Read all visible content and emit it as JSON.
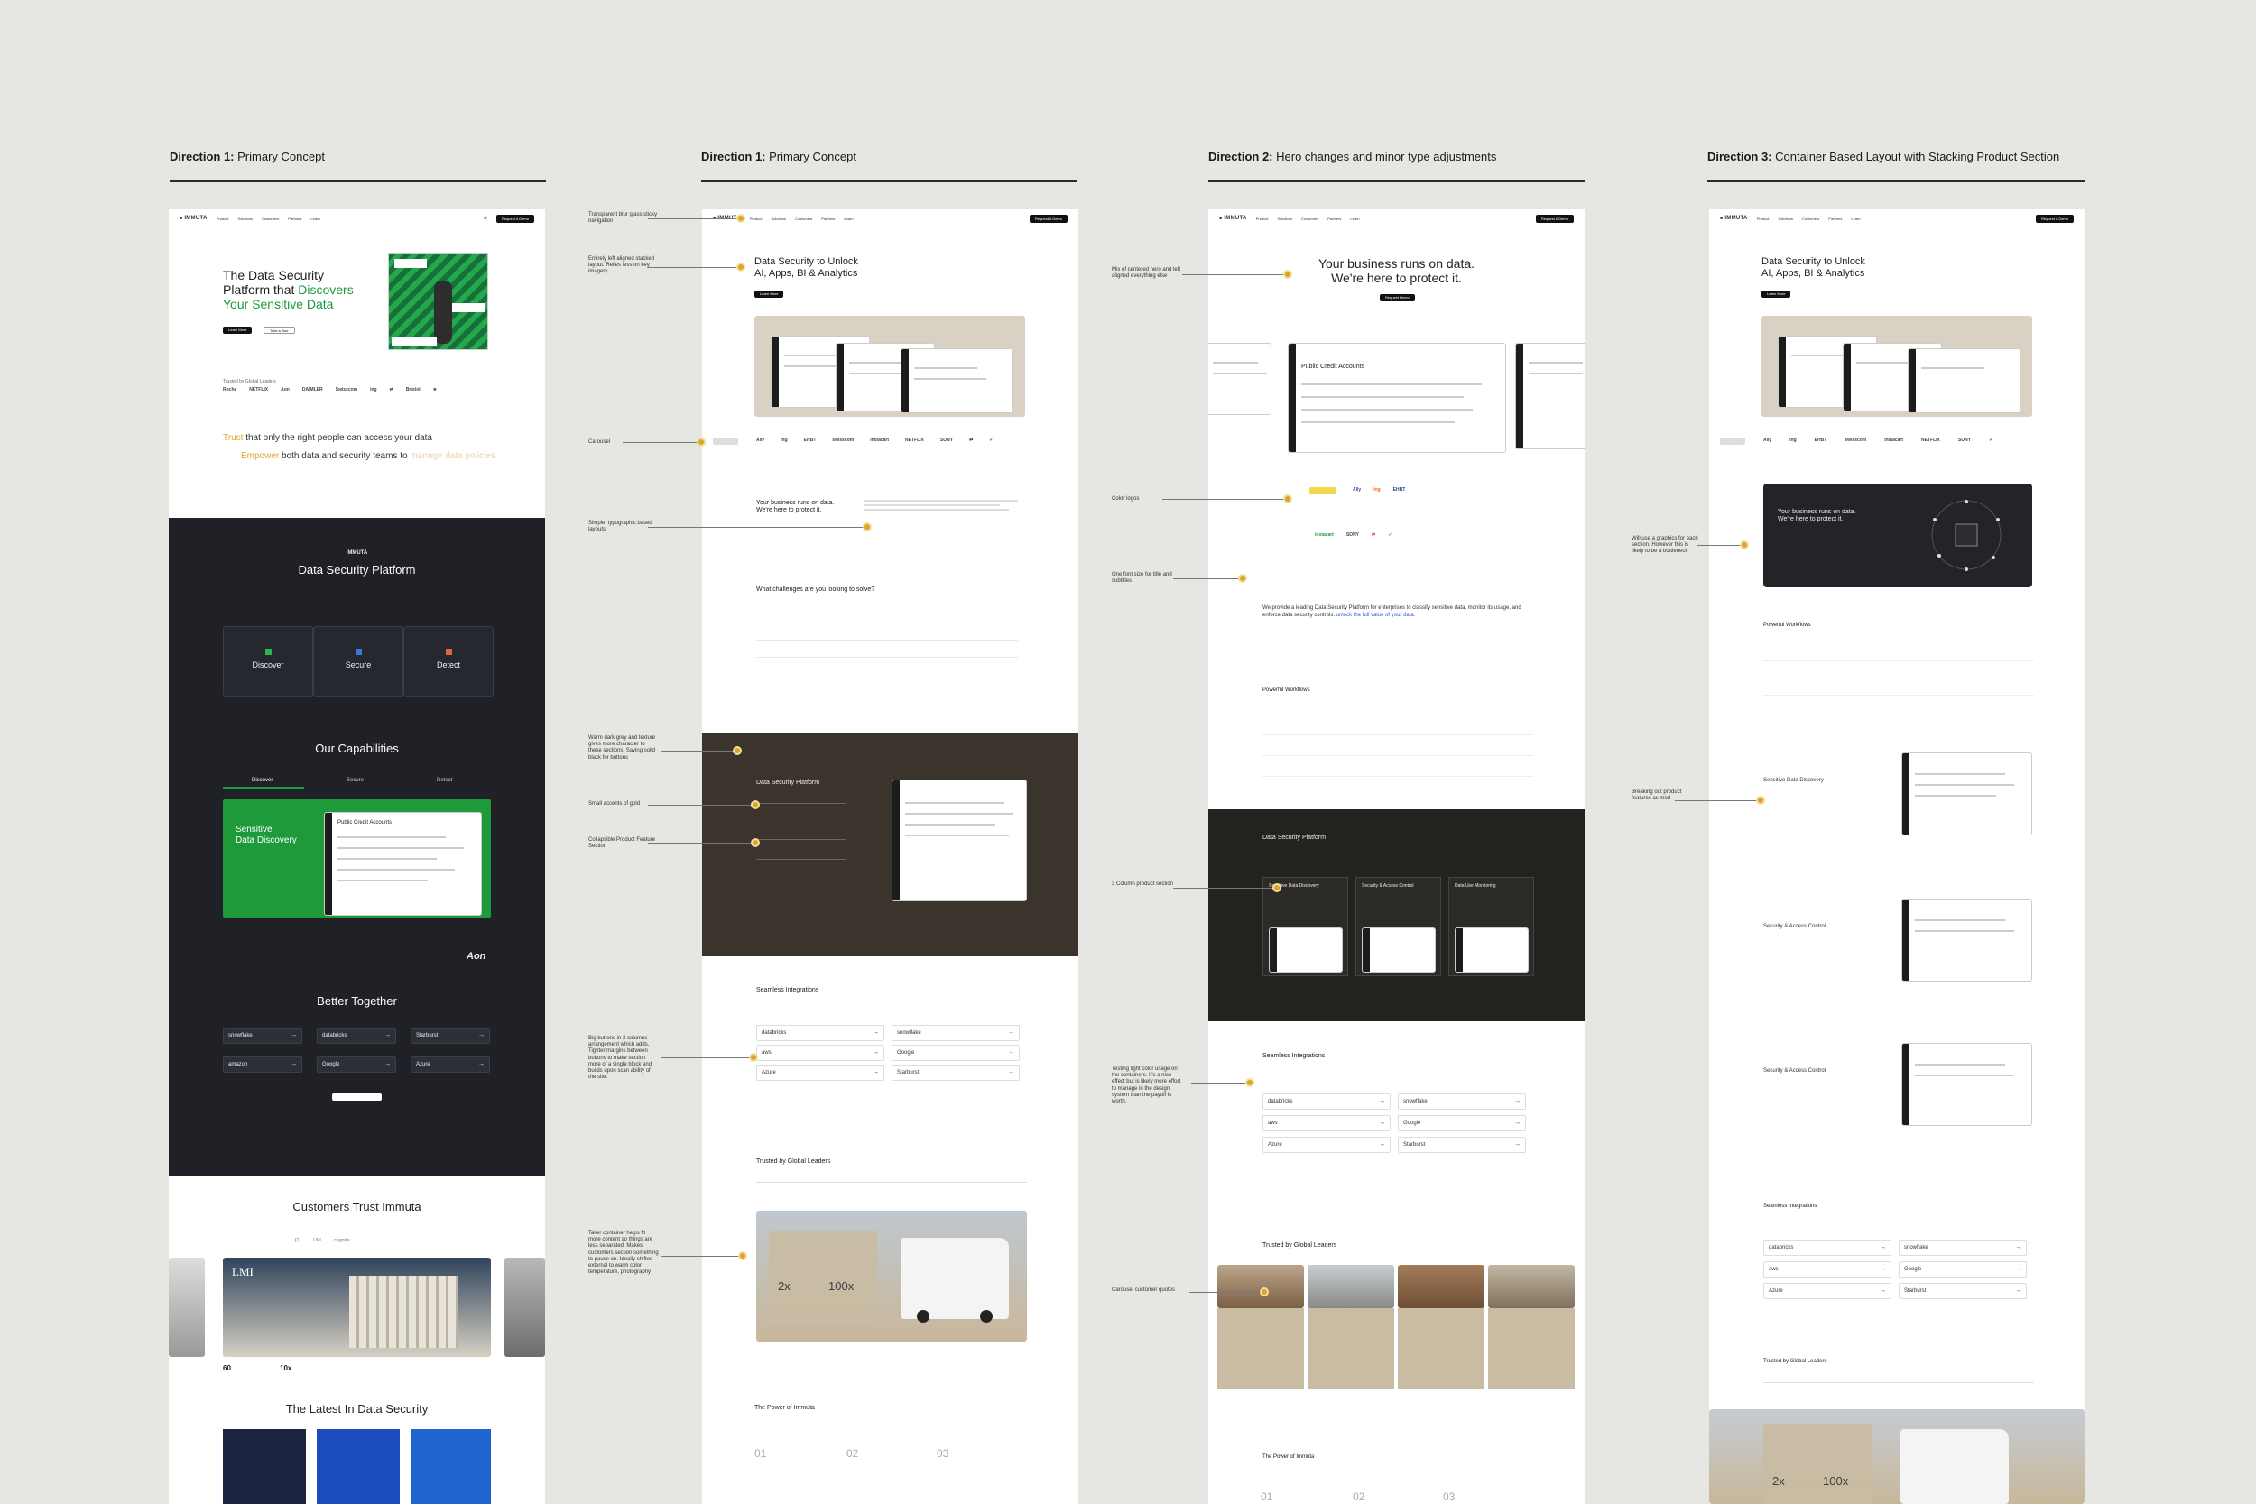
{
  "columns": [
    {
      "bold": "Direction 1:",
      "rest": " Primary Concept"
    },
    {
      "bold": "Direction 1:",
      "rest": " Primary Concept"
    },
    {
      "bold": "Direction 2:",
      "rest": " Hero changes and minor type adjustments"
    },
    {
      "bold": "Direction 3:",
      "rest": " Container Based Layout with Stacking Product Section"
    }
  ],
  "nav": {
    "logo": "IMMUTA",
    "items": [
      "Product",
      "Solutions",
      "Customers",
      "Partners",
      "Learn"
    ],
    "cta": "Request A Demo"
  },
  "b1": {
    "hero_line1": "The Data Security",
    "hero_line2a": "Platform that ",
    "hero_line2b": "Discovers",
    "hero_line3": "Your Sensitive Data",
    "btn_primary": "Learn More",
    "btn_secondary": "Take a Tour",
    "trusted_label": "Trusted by Global Leaders",
    "logos": [
      "Roche",
      "NETFLIX",
      "Aon",
      "DAIMLER",
      "Swisscom",
      "ing",
      "⇄",
      "Bristol",
      "★"
    ],
    "statement_1a": "Trust",
    "statement_1b": " that only the right people can access your data",
    "statement_2a": "Empower",
    "statement_2b": " both data and security teams to ",
    "statement_2c": "manage data policies",
    "platform_title": "Data Security Platform",
    "platform_logo": "IMMUTA",
    "cards": [
      "Discover",
      "Secure",
      "Detect"
    ],
    "capabilities_title": "Our Capabilities",
    "cap_tabs": [
      "Discover",
      "Secure",
      "Detect"
    ],
    "green_title_1": "Sensitive",
    "green_title_2": "Data Discovery",
    "screen_title": "Public Credit Accounts",
    "better_title": "Better Together",
    "integrations": [
      "snowflake",
      "databricks",
      "Starburst",
      "amazon",
      "Google",
      "Azure"
    ],
    "customers_title": "Customers Trust Immuta",
    "customer_logos": [
      "[1]",
      "LMI",
      "cognite"
    ],
    "stat_1": "60",
    "stat_2": "10x",
    "latest_title": "The Latest In Data Security",
    "photo_label": "LMI"
  },
  "b2": {
    "hero_line1": "Data Security to Unlock",
    "hero_line2": "AI, Apps, BI & Analytics",
    "btn": "Learn More",
    "logos": [
      "Ally",
      "ing",
      "EHBT",
      "swisscom",
      "instacart",
      "NETFLIX",
      "SONY",
      "⇄",
      "✓"
    ],
    "biz_line1": "Your business runs on data.",
    "biz_line2": "We're here to protect it.",
    "challenge_title": "What challenges are you looking to solve?",
    "platform_title": "Data Security Platform",
    "integ_title": "Seamless Integrations",
    "integrations": [
      "databricks",
      "snowflake",
      "aws",
      "Google",
      "Azure",
      "Starburst"
    ],
    "trusted_title": "Trusted by Global Leaders",
    "stat_1": "2x",
    "stat_2": "100x",
    "power_title": "The Power of Immuta",
    "steps": [
      "01",
      "02",
      "03"
    ]
  },
  "b3": {
    "hero_line1": "Your business runs on data.",
    "hero_line2": "We're here to protect it.",
    "btn": "Request Demo",
    "screen_title": "Public Credit Accounts",
    "logos": [
      "Ally",
      "ing",
      "EHBT",
      "instacart",
      "SONY",
      "⇄",
      "✓"
    ],
    "para_a": "We provide a leading Data Security Platform for enterprises to classify sensitive data, monitor its usage, and enforce data security controls. ",
    "para_b": "unlock the full value of your data.",
    "workflow_title": "Powerful Workflows",
    "platform_title": "Data Security Platform",
    "cols": [
      "Sensitive Data Discovery",
      "Security & Access Control",
      "Data Use Monitoring"
    ],
    "integ_title": "Seamless Integrations",
    "integrations": [
      "databricks",
      "snowflake",
      "aws",
      "Google",
      "Azure",
      "Starburst"
    ],
    "trusted_title": "Trusted by Global Leaders",
    "power_title": "The Power of Immuta",
    "steps": [
      "01",
      "02",
      "03"
    ]
  },
  "b4": {
    "hero_line1": "Data Security to Unlock",
    "hero_line2": "AI, Apps, BI & Analytics",
    "btn": "Learn More",
    "logos": [
      "Ally",
      "ing",
      "EHBT",
      "swisscom",
      "instacart",
      "NETFLIX",
      "SONY",
      "✓"
    ],
    "biz_line1": "Your business runs on data.",
    "biz_line2": "We're here to protect it.",
    "workflow_title": "Powerful Workflows",
    "feature_1": "Sensitive Data Discovery",
    "feature_2": "Security & Access Control",
    "feature_3": "Security & Access Control",
    "integ_title": "Seamless Integrations",
    "integrations": [
      "databricks",
      "snowflake",
      "aws",
      "Google",
      "Azure",
      "Starburst"
    ],
    "trusted_title": "Trusted by Global Leaders",
    "stat_1": "2x",
    "stat_2": "100x"
  },
  "notes": [
    "Transparent blur glass sticky navigation",
    "Entirely left aligned stacked layout. Relies less on key imagery",
    "Carousel",
    "Simple, typographic based layouts",
    "Warm dark grey and texture gives more character to these sections. Saving solid black for buttons",
    "Small accents of gold",
    "Collapsible Product Feature Section",
    "Big buttons in 2 columns arrangement which adds. Tighter margins between buttons to make section more of a single block and builds upon scan ability of the site.",
    "Taller container helps fit more content so things are less separated. Makes customers section something to pause on. Ideally shifted external to warm color temperature, photography",
    "Mix of centered hero and left aligned everything else",
    "Color logos",
    "One font size for title and subtitles",
    "3 Column product section",
    "Testing light color usage on the containers. It's a nice effect but is likely more effort to manage in the design system than the payoff is worth.",
    "Carousel customer quotes",
    "Will use a graphics for each section. However this is likely to be a bottleneck",
    "Breaking out product features as mod"
  ]
}
